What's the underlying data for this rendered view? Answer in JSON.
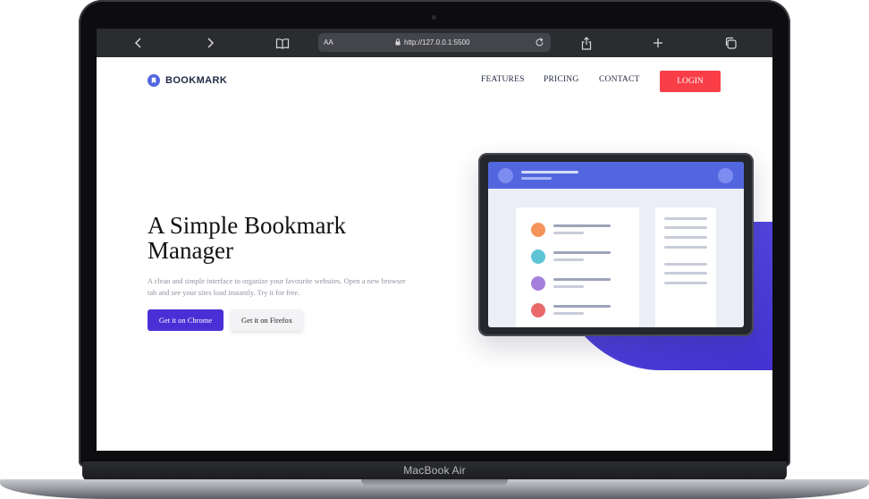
{
  "browser": {
    "aa_label": "AA",
    "url": "http://127.0.0.1:5500"
  },
  "device": {
    "model_label": "MacBook Air"
  },
  "site": {
    "logo_text": "BOOKMARK",
    "nav": {
      "features": "FEATURES",
      "pricing": "PRICING",
      "contact": "CONTACT",
      "login": "LOGIN"
    },
    "hero": {
      "title": "A Simple Bookmark Manager",
      "description": "A clean and simple interface to organize your favourite websites. Open a new browser tab and see your sites load instantly. Try it for free.",
      "chrome_button": "Get it on Chrome",
      "firefox_button": "Get it on Firefox"
    }
  },
  "colors": {
    "brand_blue": "#5267df",
    "login_red": "#fa3e47",
    "primary_purple": "#4b2fd6",
    "bookmark_dots": [
      "#f4945a",
      "#5fc3d6",
      "#a47fdb",
      "#ea6a6c"
    ]
  },
  "icons": [
    "back-icon",
    "forward-icon",
    "bookmarks-icon",
    "lock-icon",
    "reload-icon",
    "share-icon",
    "new-tab-icon",
    "tabs-icon",
    "bookmark-logo-icon"
  ]
}
